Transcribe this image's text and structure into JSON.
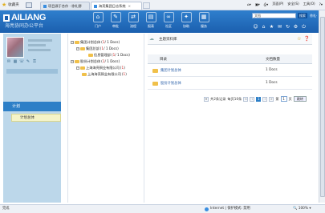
{
  "browser": {
    "favorites_label": "收藏夹",
    "tabs": [
      {
        "label": "项目源于合作 · 徐礼野",
        "active": false
      },
      {
        "label": "海亮集团日志系统",
        "active": true
      }
    ],
    "tools": [
      "页面(P)",
      "安全(S)",
      "工具(O)"
    ]
  },
  "header": {
    "brand": "AILIANG",
    "subtitle": "海亮协同办公平台",
    "nav": [
      {
        "label": "门户",
        "icon": "home-icon",
        "glyph": "⌂"
      },
      {
        "label": "审批",
        "icon": "approve-icon",
        "glyph": "✎"
      },
      {
        "label": "流程",
        "icon": "flow-icon",
        "glyph": "⇄"
      },
      {
        "label": "报表",
        "icon": "report-icon",
        "glyph": "▤"
      },
      {
        "label": "社区",
        "icon": "community-icon",
        "glyph": "∞"
      },
      {
        "label": "协助",
        "icon": "assist-icon",
        "glyph": "✦"
      },
      {
        "label": "服务",
        "icon": "service-icon",
        "glyph": "▦"
      }
    ],
    "search_value": "文档",
    "search_button": "搜索",
    "user": "徐礼·",
    "icons": [
      "user-icon",
      "home-icon",
      "star-icon",
      "mail-icon",
      "refresh-icon",
      "settings-icon",
      "power-icon"
    ]
  },
  "left": {
    "menu_header": "计划",
    "active_item": "计划总体"
  },
  "tree": {
    "nodes": [
      {
        "indent": 0,
        "toggle": "−",
        "label": "集团计划总体",
        "count": "1",
        "docs": "1 Docs"
      },
      {
        "indent": 1,
        "toggle": "−",
        "label": "集团总部",
        "count": "1",
        "docs": "1 Docs"
      },
      {
        "indent": 2,
        "toggle": "",
        "label": "信息管理部",
        "count": "1",
        "docs": "1 Docs"
      },
      {
        "indent": 0,
        "toggle": "−",
        "label": "股份计划总体",
        "count": "1",
        "docs": "1 Docs"
      },
      {
        "indent": 1,
        "toggle": "−",
        "label": "上海海亮铜业有限公司",
        "count": "1",
        "docs": ""
      },
      {
        "indent": 2,
        "toggle": "",
        "label": "上海海亮铜业有限公司",
        "count": "1",
        "docs": ""
      }
    ]
  },
  "main": {
    "title": "主题资料库",
    "columns": [
      "目录",
      "文档数量"
    ],
    "rows": [
      {
        "name": "集团计划总体",
        "docs": "1 Docs"
      },
      {
        "name": "股份计划总体",
        "docs": "1 Docs"
      }
    ],
    "pager": {
      "total": "共2条记录",
      "per_page": "每页10条",
      "current": "1",
      "go": "跳转",
      "page_label": "第",
      "page_unit": "页"
    }
  },
  "status": {
    "left": "完成",
    "zone": "Internet | 保护模式: 禁用",
    "zoom": "100%"
  }
}
